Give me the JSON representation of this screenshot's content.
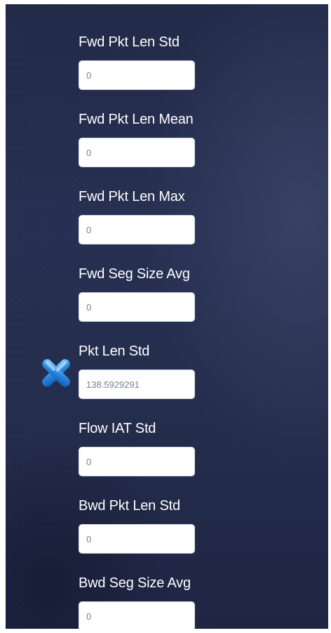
{
  "fields": [
    {
      "label": "Fwd Pkt Len Std",
      "value": "0"
    },
    {
      "label": "Fwd Pkt Len Mean",
      "value": "0"
    },
    {
      "label": "Fwd Pkt Len Max",
      "value": "0"
    },
    {
      "label": "Fwd Seg Size Avg",
      "value": "0"
    },
    {
      "label": "Pkt Len Std",
      "value": "138.5929291"
    },
    {
      "label": "Flow IAT Std",
      "value": "0"
    },
    {
      "label": "Bwd Pkt Len Std",
      "value": "0"
    },
    {
      "label": "Bwd Seg Size Avg",
      "value": "0"
    }
  ],
  "icons": {
    "pointer": "blue-x-cursor-icon"
  },
  "colors": {
    "background": "#252d4d",
    "label_text": "#ffffff",
    "input_background": "#ffffff",
    "input_text": "#7b8089",
    "icon_blue": "#2b8be0"
  }
}
